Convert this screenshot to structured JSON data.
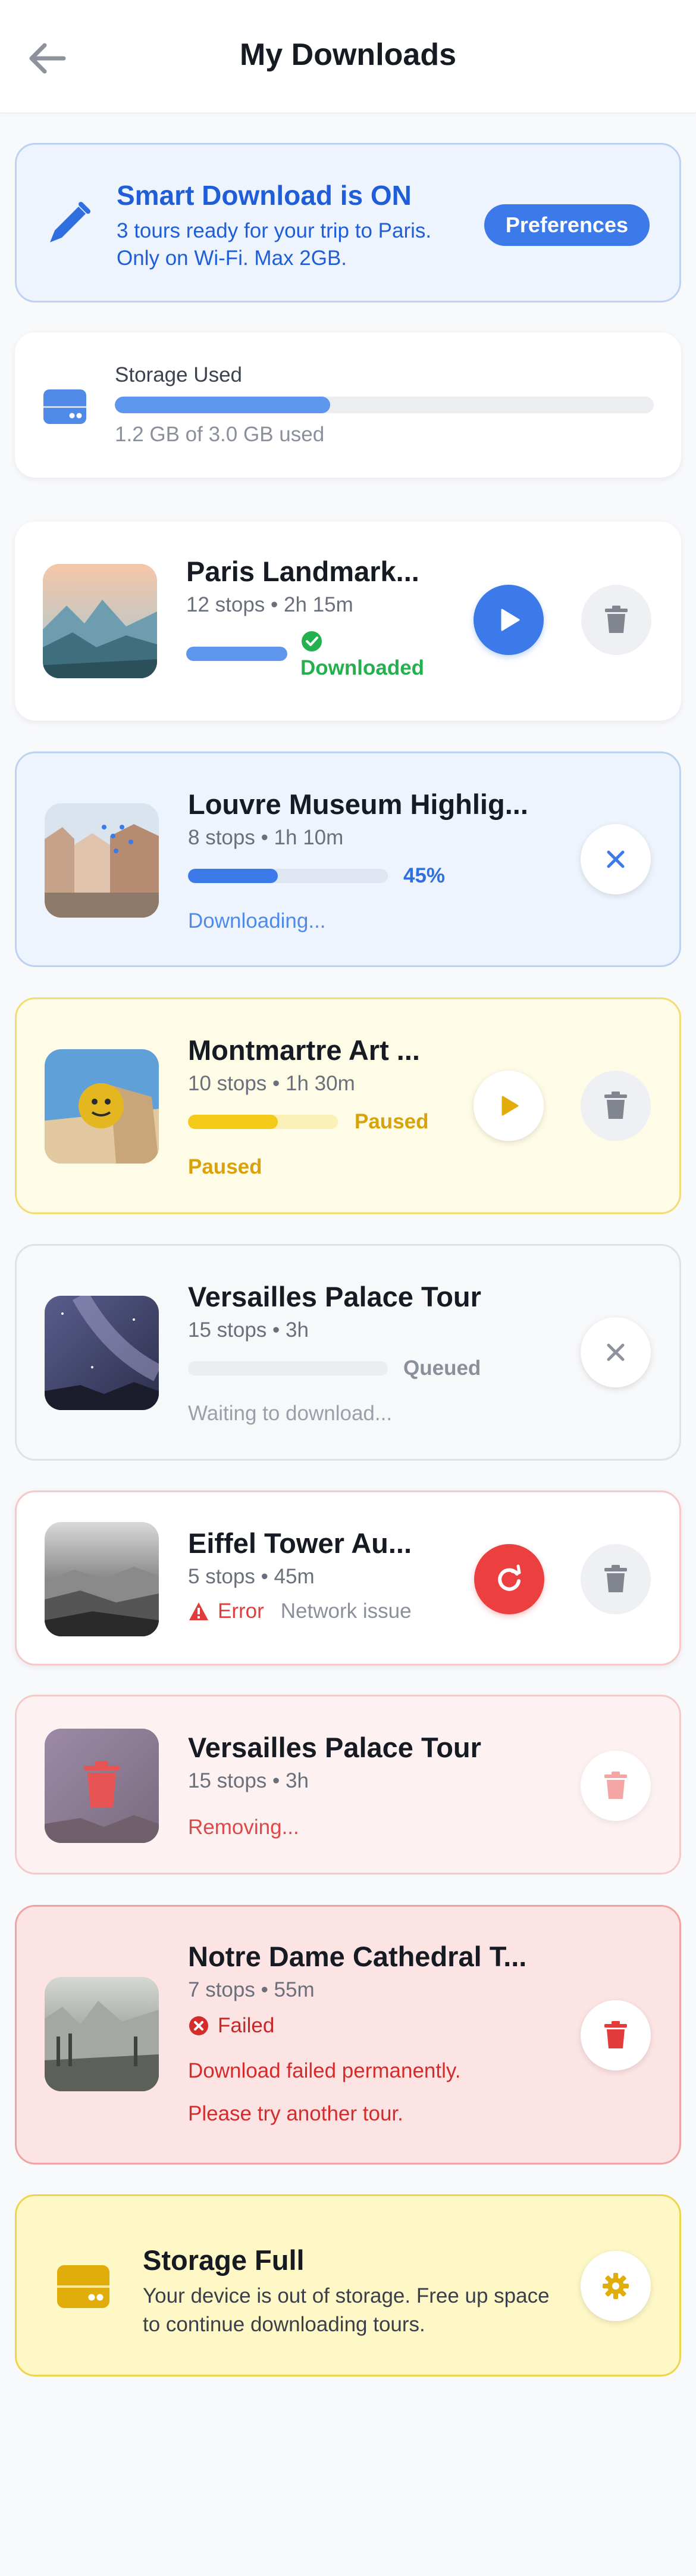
{
  "header": {
    "title": "My Downloads",
    "back_icon": "arrow-left-icon"
  },
  "smart_download": {
    "title": "Smart Download is ON",
    "subtitle": "3 tours ready for your trip to Paris. Only on Wi-Fi. Max 2GB.",
    "button_label": "Preferences",
    "icon": "pencil-icon"
  },
  "storage": {
    "label": "Storage Used",
    "used_text": "1.2 GB of 3.0 GB used",
    "used_fraction": 0.4,
    "icon": "hard-drive-icon"
  },
  "tours": [
    {
      "title": "Paris Landmark...",
      "meta": "12 stops • 2h 15m",
      "status_label": "Downloaded",
      "progress": 1.0,
      "state": "downloaded",
      "action_icon": "play-icon",
      "secondary_icon": "trash-icon"
    },
    {
      "title": "Louvre Museum Highlig...",
      "meta": "8 stops • 1h 10m",
      "percent_label": "45%",
      "progress": 0.45,
      "status_text": "Downloading...",
      "state": "downloading",
      "action_icon": "close-icon"
    },
    {
      "title": "Montmartre Art ...",
      "meta": "10 stops • 1h 30m",
      "bar_label": "Paused",
      "progress": 0.6,
      "status_text": "Paused",
      "state": "paused",
      "action_icon": "play-icon",
      "secondary_icon": "trash-icon"
    },
    {
      "title": "Versailles Palace Tour",
      "meta": "15 stops • 3h",
      "bar_label": "Queued",
      "progress": 0.0,
      "status_text": "Waiting to download...",
      "state": "queued",
      "action_icon": "close-icon"
    },
    {
      "title": "Eiffel Tower Au...",
      "meta": "5 stops • 45m",
      "error_label": "Error",
      "error_detail": "Network issue",
      "state": "error",
      "action_icon": "retry-icon",
      "secondary_icon": "trash-icon"
    },
    {
      "title": "Versailles Palace Tour",
      "meta": "15 stops • 3h",
      "status_text": "Removing...",
      "state": "removing",
      "action_icon": "trash-icon"
    },
    {
      "title": "Notre Dame Cathedral T...",
      "meta": "7 stops • 55m",
      "failed_label": "Failed",
      "message_line1": "Download failed permanently.",
      "message_line2": "Please try another tour.",
      "state": "failed",
      "action_icon": "trash-icon"
    }
  ],
  "storage_full": {
    "title": "Storage Full",
    "message": "Your device is out of storage. Free up space to continue downloading tours.",
    "icon": "hard-drive-icon",
    "action_icon": "gear-icon"
  },
  "colors": {
    "accent": "#3b7ae8",
    "success": "#22b14c",
    "warning": "#e0ad0a",
    "danger": "#ec4040",
    "progress": "#5e95ed"
  }
}
